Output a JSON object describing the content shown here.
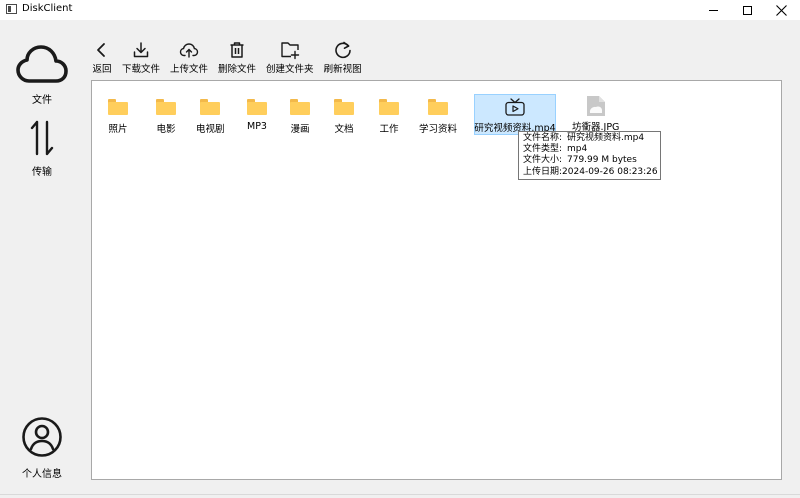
{
  "window": {
    "title": "DiskClient"
  },
  "sidebar": {
    "files_label": "文件",
    "transfer_label": "传输",
    "profile_label": "个人信息"
  },
  "toolbar": {
    "items": [
      {
        "label": "返回",
        "icon": "back-arrow-icon"
      },
      {
        "label": "下载文件",
        "icon": "download-icon"
      },
      {
        "label": "上传文件",
        "icon": "cloud-upload-icon"
      },
      {
        "label": "删除文件",
        "icon": "trash-icon"
      },
      {
        "label": "创建文件夹",
        "icon": "folder-add-icon"
      },
      {
        "label": "刷新视图",
        "icon": "refresh-icon"
      }
    ]
  },
  "files": {
    "items": [
      {
        "name": "照片",
        "type": "folder"
      },
      {
        "name": "电影",
        "type": "folder"
      },
      {
        "name": "电视剧",
        "type": "folder"
      },
      {
        "name": "MP3",
        "type": "folder"
      },
      {
        "name": "漫画",
        "type": "folder"
      },
      {
        "name": "文档",
        "type": "folder"
      },
      {
        "name": "工作",
        "type": "folder"
      },
      {
        "name": "学习资料",
        "type": "folder"
      },
      {
        "name": "研究视频资料.mp4",
        "type": "video",
        "selected": true
      },
      {
        "name": "坊衝器.JPG",
        "type": "image"
      }
    ]
  },
  "tooltip": {
    "name_key": "文件名称:",
    "name_value": "研究视频资料.mp4",
    "type_key": "文件类型:",
    "type_value": "mp4",
    "size_key": "文件大小:",
    "size_value": "779.99 M bytes",
    "date_key": "上传日期:",
    "date_value": "2024-09-26 08:23:26"
  },
  "colors": {
    "folder": "#ffce5c",
    "selection": "#cce8ff",
    "selection_border": "#99d1ff"
  }
}
